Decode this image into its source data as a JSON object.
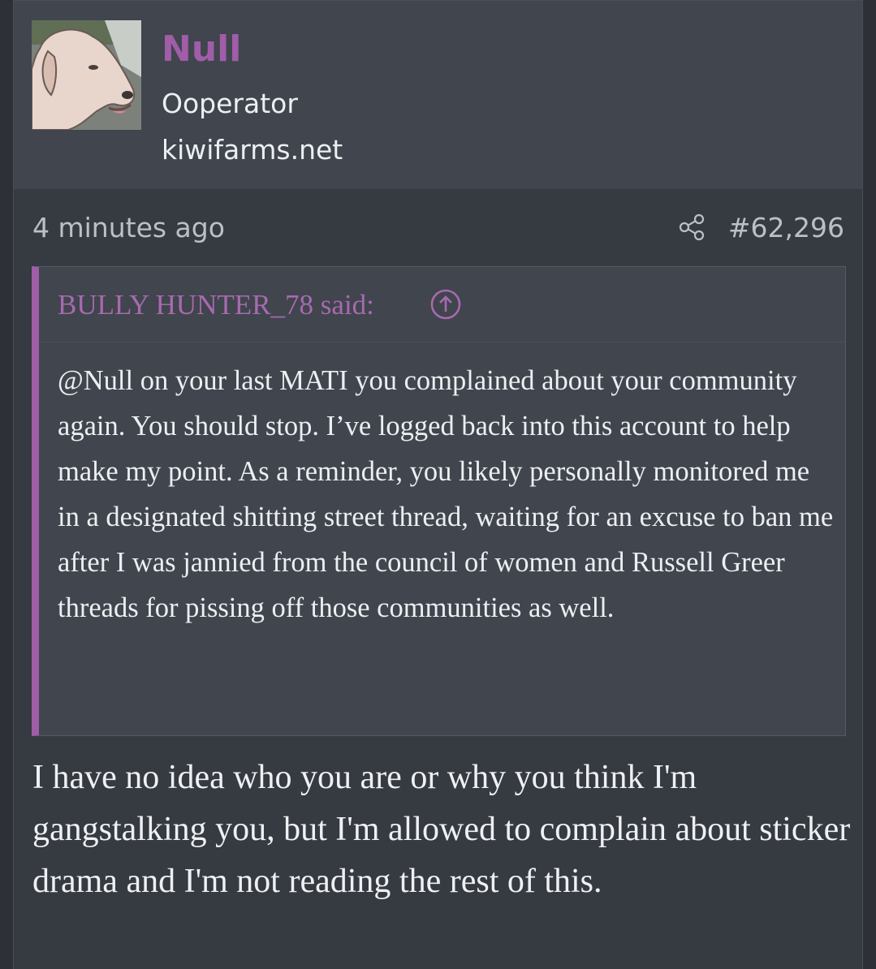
{
  "user": {
    "name": "Null",
    "title": "Ooperator",
    "extra": "kiwifarms.net",
    "avatar_icon": "dog-avatar"
  },
  "meta": {
    "timestamp": "4 minutes ago",
    "share_icon": "share-icon",
    "post_number": "#62,296"
  },
  "quote": {
    "author_line": "BULLY HUNTER_78 said:",
    "jump_icon": "arrow-up-circle-icon",
    "body": "@Null on your last MATI you complained about your community again. You should stop. I’ve logged back into this account to help make my point. As a reminder, you likely personally monitored me in a designated shitting street thread, waiting for an excuse to ban me after I was jannied from the council of women and Russell Greer threads for pissing off those communities as well."
  },
  "reply": {
    "body": "I have no idea who you are or why you think I'm gangstalking you, but I'm allowed to complain about sticker drama and I'm not reading the rest of this."
  },
  "colors": {
    "accent": "#a05da8",
    "text": "#eceff2",
    "muted": "#bcc0c6",
    "header_bg": "#41454d",
    "post_bg": "#363a41"
  }
}
